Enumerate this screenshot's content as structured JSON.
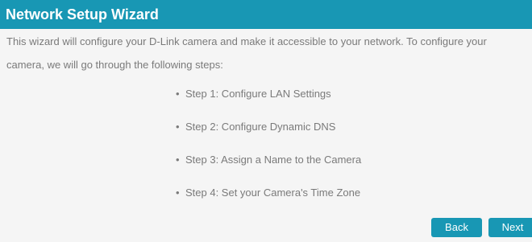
{
  "header": {
    "title": "Network Setup Wizard"
  },
  "intro": {
    "line1": "This wizard will configure your D-Link camera and make it accessible to your network. To configure your",
    "line2": "camera, we will go through the following steps:"
  },
  "steps": [
    {
      "label": "Step 1: Configure LAN Settings"
    },
    {
      "label": "Step 2: Configure Dynamic DNS"
    },
    {
      "label": "Step 3: Assign a Name to the Camera"
    },
    {
      "label": "Step 4: Set your Camera's Time Zone"
    }
  ],
  "buttons": {
    "back_label": "Back",
    "next_label": "Next"
  },
  "colors": {
    "accent": "#1897b4",
    "background": "#f5f5f5",
    "text": "#7a7a7a"
  }
}
